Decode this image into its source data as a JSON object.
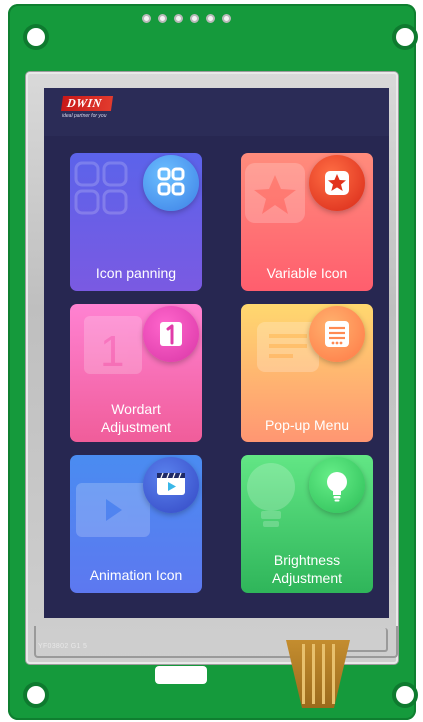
{
  "device": {
    "brand": "DWIN",
    "tagline": "ideal partner for you",
    "pcb_marking": "YF03802  G1 5"
  },
  "cards": [
    {
      "label": "Icon panning",
      "icon": "grid-four-squares-icon",
      "gradient": [
        "#5a63e6",
        "#7d5de0"
      ],
      "bubble": [
        "#5fb0f5",
        "#3f86e8"
      ]
    },
    {
      "label": "Variable Icon",
      "icon": "star-icon",
      "gradient": [
        "#ff8a78",
        "#ff5f6d"
      ],
      "bubble": [
        "#ff6b4a",
        "#e2331c"
      ]
    },
    {
      "label": "Wordart Adjustment",
      "icon": "number-one-icon",
      "gradient": [
        "#ff7ec7",
        "#f2609e"
      ],
      "bubble": [
        "#ff5fc2",
        "#e03aa8"
      ]
    },
    {
      "label": "Pop-up Menu",
      "icon": "menu-card-icon",
      "gradient": [
        "#ffd36e",
        "#ff9a6a"
      ],
      "bubble": [
        "#ffb06c",
        "#ff7c4c"
      ]
    },
    {
      "label": "Animation Icon",
      "icon": "video-player-icon",
      "gradient": [
        "#4a86f0",
        "#5f7af2"
      ],
      "bubble": [
        "#4a6fe0",
        "#384fcc"
      ]
    },
    {
      "label": "Brightness Adjustment",
      "icon": "light-bulb-icon",
      "gradient": [
        "#5ee07e",
        "#2fb55b"
      ],
      "bubble": [
        "#59e37c",
        "#2fbf58"
      ]
    }
  ]
}
